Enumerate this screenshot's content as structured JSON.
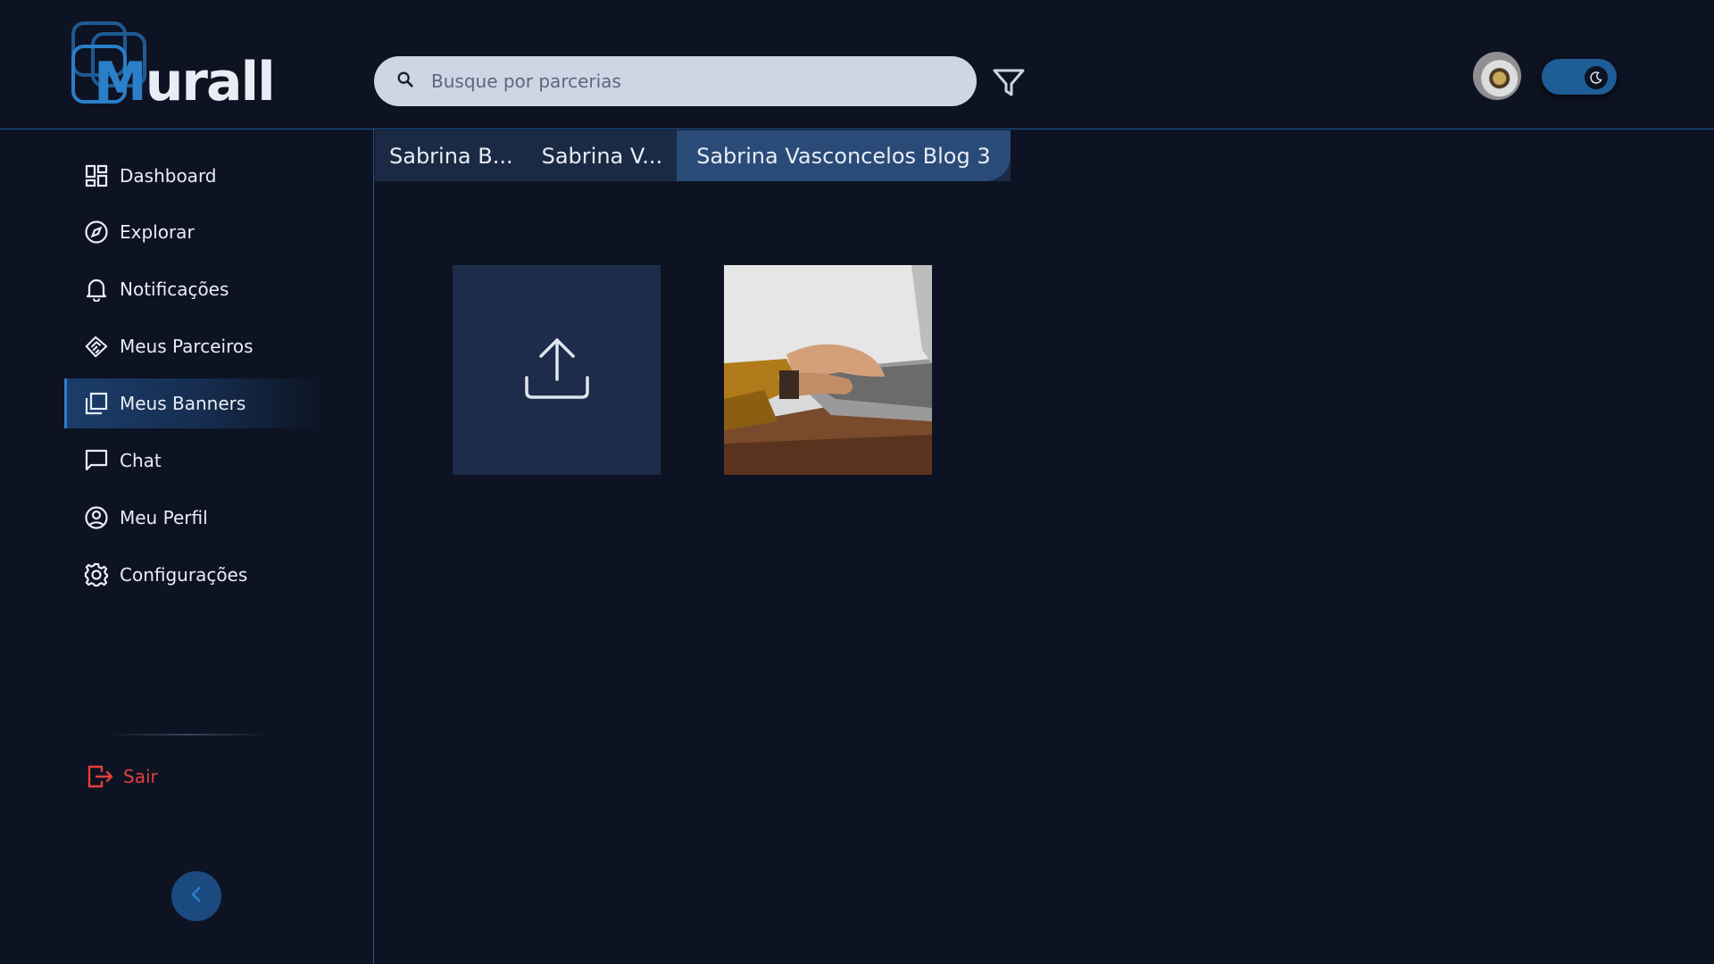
{
  "header": {
    "logo_text_m": "M",
    "logo_text_rest": "urall",
    "search_placeholder": "Busque por parcerias"
  },
  "sidebar": {
    "items": [
      {
        "label": "Dashboard",
        "icon": "dashboard-icon"
      },
      {
        "label": "Explorar",
        "icon": "compass-icon"
      },
      {
        "label": "Notificações",
        "icon": "bell-icon"
      },
      {
        "label": "Meus Parceiros",
        "icon": "handshake-icon"
      },
      {
        "label": "Meus Banners",
        "icon": "banners-icon",
        "active": true
      },
      {
        "label": "Chat",
        "icon": "chat-icon"
      },
      {
        "label": "Meu Perfil",
        "icon": "profile-icon"
      },
      {
        "label": "Configurações",
        "icon": "gear-icon"
      }
    ],
    "logout_label": "Sair"
  },
  "tabs": [
    {
      "label": "Sabrina B..."
    },
    {
      "label": "Sabrina V..."
    },
    {
      "label": "Sabrina Vasconcelos Blog 3",
      "active": true
    }
  ],
  "colors": {
    "background": "#0d1322",
    "accent": "#2b7ec8",
    "logout": "#e53e3e",
    "active_tab": "#2a4a78"
  }
}
